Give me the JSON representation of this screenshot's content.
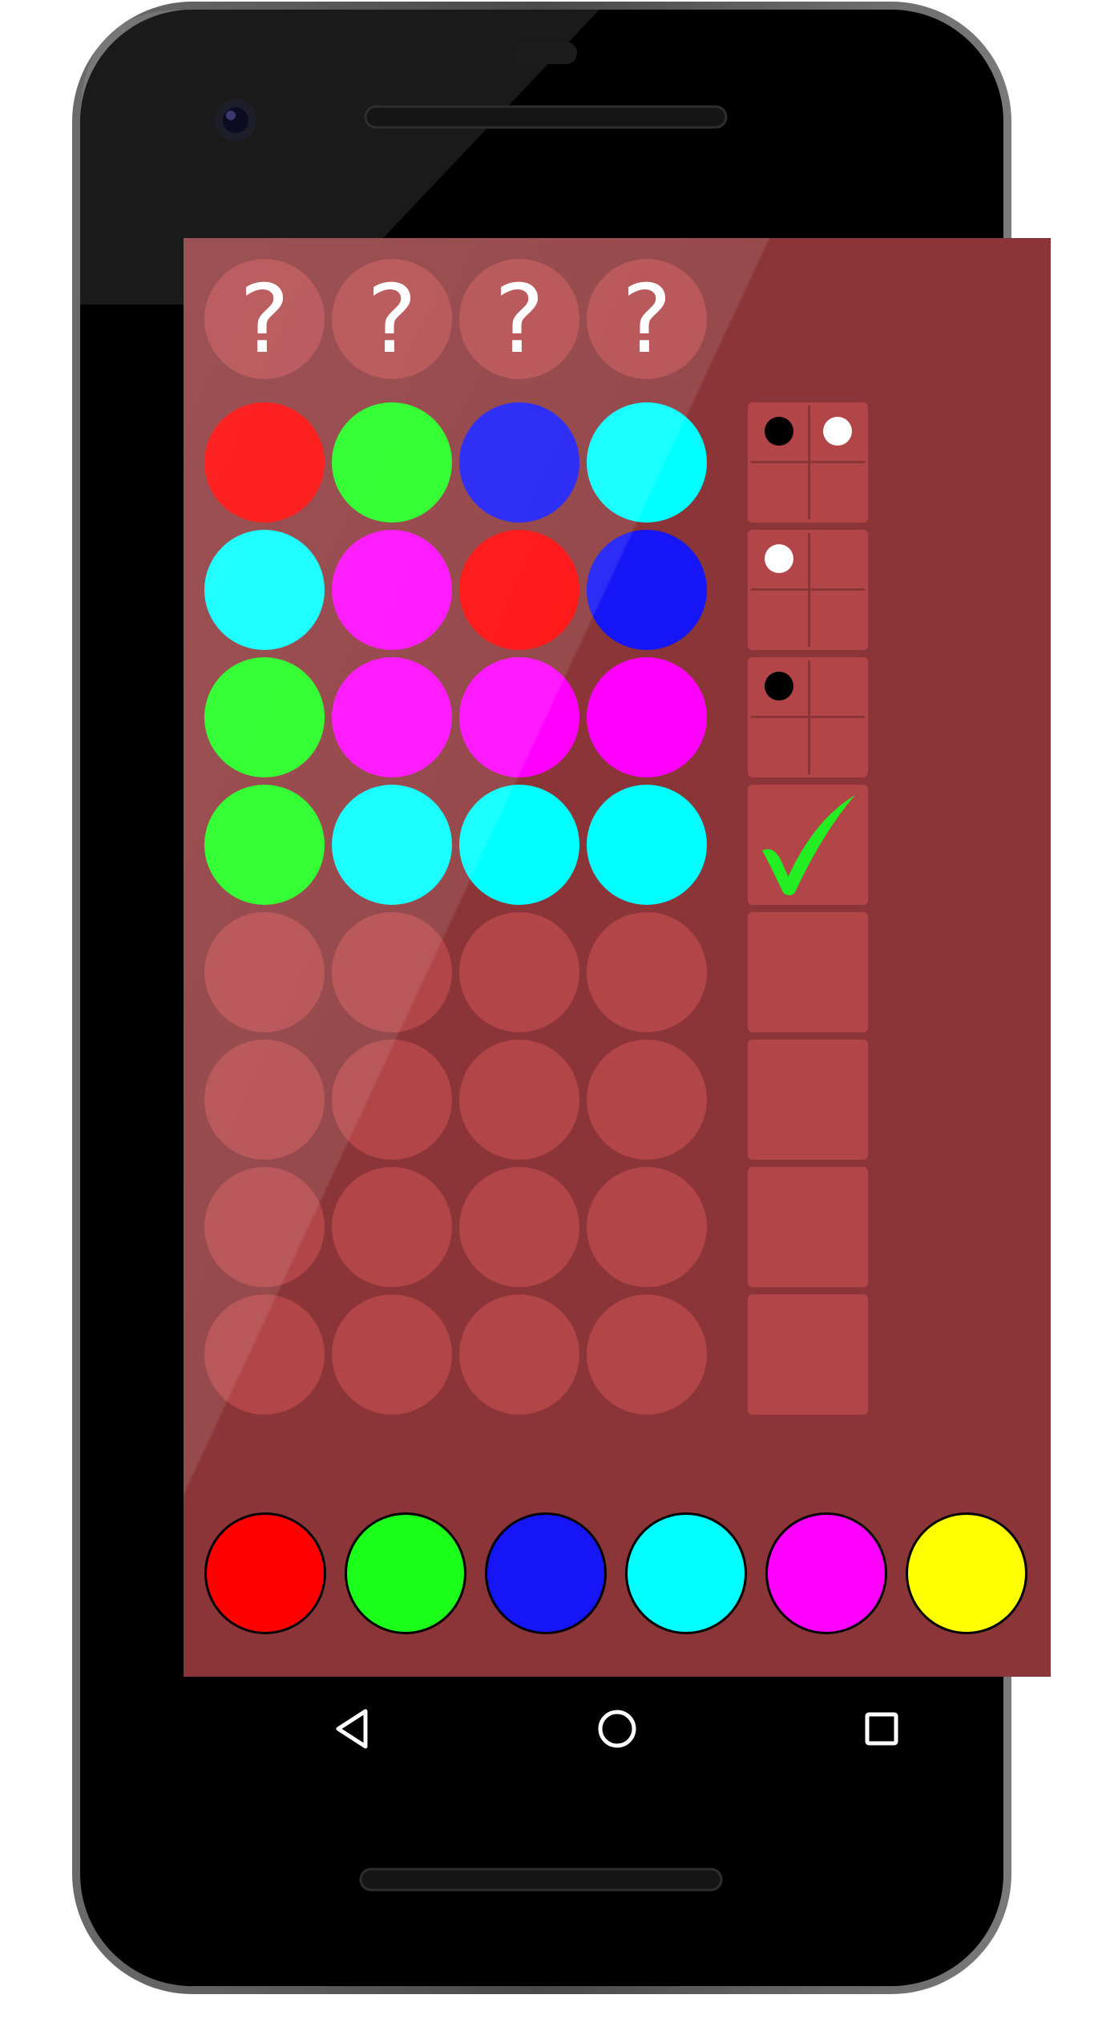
{
  "secret": {
    "glyphs": [
      "?",
      "?",
      "?",
      "?"
    ]
  },
  "colors": {
    "red": "#ff0000",
    "green": "#1bff1b",
    "blue": "#1515f6",
    "cyan": "#00ffff",
    "magenta": "#ff00ff",
    "yellow": "#ffff00",
    "empty": "#b14548",
    "board": "#8b3538",
    "check": "#22ee22"
  },
  "guesses": [
    {
      "pegs": [
        "red",
        "green",
        "blue",
        "cyan"
      ],
      "feedback": {
        "black": 1,
        "white": 1
      }
    },
    {
      "pegs": [
        "cyan",
        "magenta",
        "red",
        "blue"
      ],
      "feedback": {
        "black": 0,
        "white": 1
      }
    },
    {
      "pegs": [
        "green",
        "magenta",
        "magenta",
        "magenta"
      ],
      "feedback": {
        "black": 1,
        "white": 0
      }
    },
    {
      "pegs": [
        "green",
        "cyan",
        "cyan",
        "cyan"
      ],
      "feedback": {
        "solved": true
      }
    },
    {
      "pegs": [
        null,
        null,
        null,
        null
      ],
      "feedback": null
    },
    {
      "pegs": [
        null,
        null,
        null,
        null
      ],
      "feedback": null
    },
    {
      "pegs": [
        null,
        null,
        null,
        null
      ],
      "feedback": null
    },
    {
      "pegs": [
        null,
        null,
        null,
        null
      ],
      "feedback": null
    }
  ],
  "palette": [
    "red",
    "green",
    "blue",
    "cyan",
    "magenta",
    "yellow"
  ],
  "navbar": {
    "icons": [
      "back-triangle-icon",
      "home-circle-icon",
      "recents-square-icon"
    ]
  }
}
